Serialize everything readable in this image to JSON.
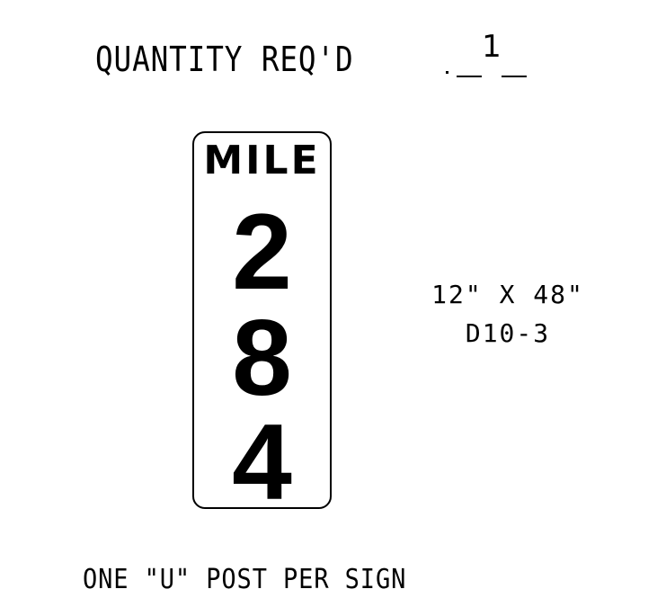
{
  "quantity": {
    "label": "QUANTITY REQ'D",
    "value": "1"
  },
  "sign": {
    "title": "MILE",
    "digits": [
      "2",
      "8",
      "4"
    ]
  },
  "spec": {
    "size": "12\" X 48\"",
    "code": "D10-3"
  },
  "footer": {
    "note": "ONE \"U\" POST PER SIGN"
  }
}
